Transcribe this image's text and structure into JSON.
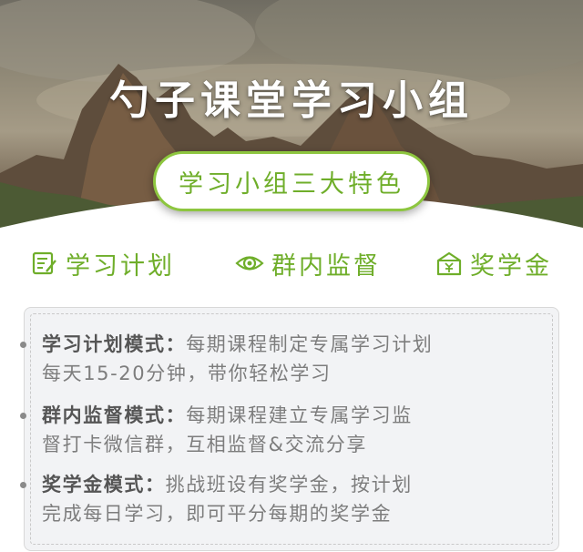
{
  "hero": {
    "title": "勺子课堂学习小组",
    "pill_label": "学习小组三大特色"
  },
  "features": [
    {
      "label": "学习计划",
      "icon": "plan-icon"
    },
    {
      "label": "群内监督",
      "icon": "eye-icon"
    },
    {
      "label": "奖学金",
      "icon": "scholarship-icon"
    }
  ],
  "items": [
    {
      "head": "学习计划模式：",
      "line1": "每期课程制定专属学习计划",
      "line2": "每天15-20分钟，带你轻松学习"
    },
    {
      "head": "群内监督模式：",
      "line1": "每期课程建立专属学习监",
      "line2": "督打卡微信群，互相监督&交流分享"
    },
    {
      "head": "奖学金模式：",
      "line1": "挑战班设有奖学金，按计划",
      "line2": "完成每日学习，即可平分每期的奖学金"
    }
  ],
  "colors": {
    "accent_green": "#6fae2a",
    "pill_border": "#8dc63f",
    "text_gray": "#7d7d7d"
  }
}
